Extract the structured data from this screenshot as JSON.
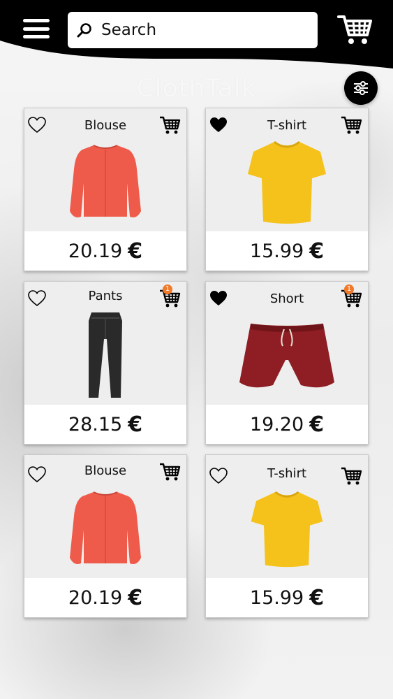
{
  "app": {
    "brand": "ClothTalk"
  },
  "search": {
    "placeholder": "Search"
  },
  "colors": {
    "header_bg": "#000000",
    "accent_badge": "#f07a2a",
    "blouse": "#ef5b4b",
    "tshirt": "#f5c21b",
    "short": "#8e1d24",
    "pants": "#2a2a2a"
  },
  "products": [
    {
      "title": "Blouse",
      "price": "20.19",
      "currency": "€",
      "favorited": false,
      "cart_count": "",
      "image": "blouse"
    },
    {
      "title": "T-shirt",
      "price": "15.99",
      "currency": "€",
      "favorited": true,
      "cart_count": "",
      "image": "tshirt"
    },
    {
      "title": "Pants",
      "price": "28.15",
      "currency": "€",
      "favorited": false,
      "cart_count": "1",
      "image": "pants"
    },
    {
      "title": "Short",
      "price": "19.20",
      "currency": "€",
      "favorited": true,
      "cart_count": "1",
      "image": "short"
    },
    {
      "title": "Blouse",
      "price": "20.19",
      "currency": "€",
      "favorited": false,
      "cart_count": "",
      "image": "blouse"
    },
    {
      "title": "T-shirt",
      "price": "15.99",
      "currency": "€",
      "favorited": false,
      "cart_count": "",
      "image": "tshirt"
    }
  ]
}
